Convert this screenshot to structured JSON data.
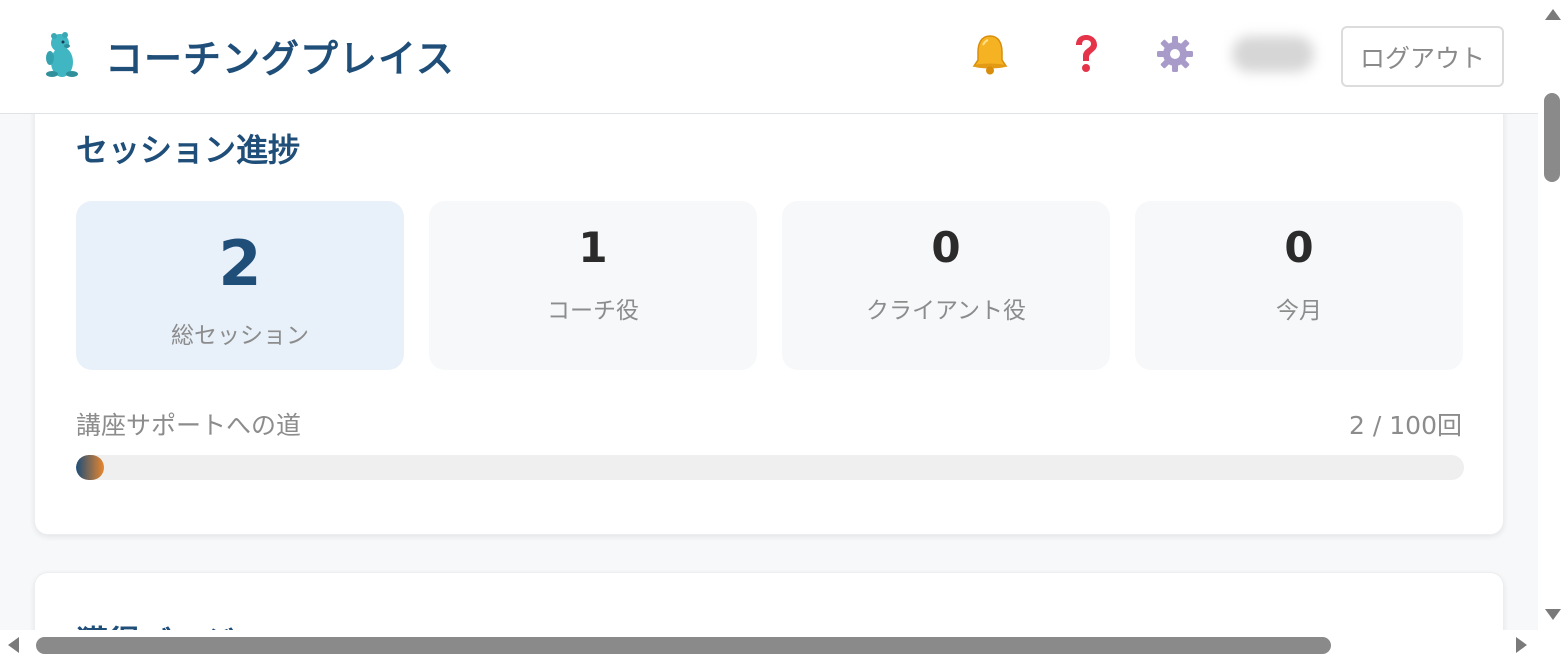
{
  "header": {
    "app_title": "コーチングプレイス",
    "logo_icon": "otter-mascot-icon",
    "icons": [
      "bell-icon",
      "question-icon",
      "gear-icon"
    ],
    "logout_label": "ログアウト"
  },
  "session_progress": {
    "title": "セッション進捗",
    "stats": [
      {
        "value": "2",
        "label": "総セッション"
      },
      {
        "value": "1",
        "label": "コーチ役"
      },
      {
        "value": "0",
        "label": "クライアント役"
      },
      {
        "value": "0",
        "label": "今月"
      }
    ],
    "progress_label": "講座サポートへの道",
    "progress_count": "2 / 100回",
    "progress_value": 2,
    "progress_max": 100
  },
  "badges": {
    "title": "獲得バッジ"
  },
  "colors": {
    "brand": "#1f4e79",
    "accent": "#e8862d",
    "active_stat_bg": "#e8f1fa"
  }
}
